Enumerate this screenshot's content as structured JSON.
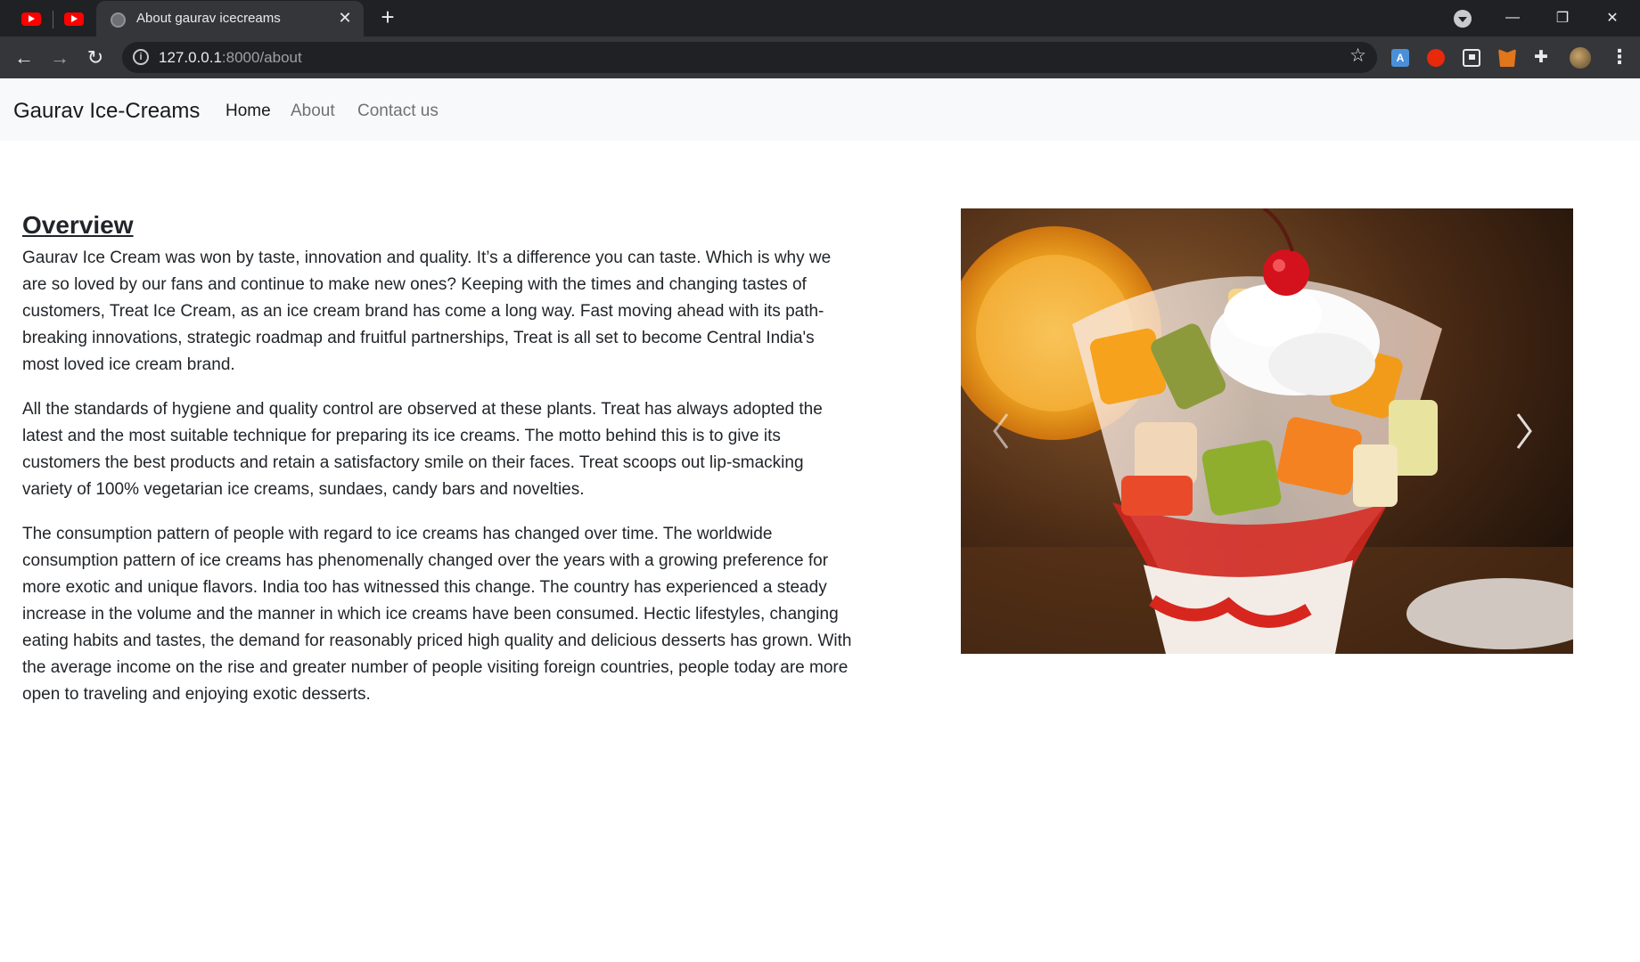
{
  "browser": {
    "active_tab_title": "About gaurav icecreams",
    "close_tab_glyph": "✕",
    "new_tab_glyph": "+",
    "url_host": "127.0.0.1",
    "url_path": ":8000/about",
    "icons": {
      "pinned_tab_1": "youtube-icon",
      "pinned_tab_2": "youtube-icon",
      "back": "back-arrow-icon",
      "forward": "forward-arrow-icon",
      "reload": "reload-icon",
      "site_info": "info-icon",
      "bookmark": "star-icon",
      "extensions": "puzzle-icon",
      "menu": "kebab-menu-icon"
    }
  },
  "navbar": {
    "brand": "Gaurav Ice-Creams",
    "links": [
      "Home",
      "About",
      "Contact us"
    ],
    "background_color": "#f8f9fa"
  },
  "main": {
    "heading": "Overview",
    "paragraphs": [
      "Gaurav Ice Cream was won by taste, innovation and quality. It’s a difference you can taste. Which is why we are so loved by our fans and continue to make new ones? Keeping with the times and changing tastes of customers, Treat Ice Cream, as an ice cream brand has come a long way. Fast moving ahead with its path-breaking innovations, strategic roadmap and fruitful partnerships, Treat is all set to become Central India's most loved ice cream brand.",
      "All the standards of hygiene and quality control are observed at these plants. Treat has always adopted the latest and the most suitable technique for preparing its ice creams. The motto behind this is to give its customers the best products and retain a satisfactory smile on their faces. Treat scoops out lip-smacking variety of 100% vegetarian ice creams, sundaes, candy bars and novelties.",
      "The consumption pattern of people with regard to ice creams has changed over time. The worldwide consumption pattern of ice creams has phenomenally changed over the years with a growing preference for more exotic and unique flavors. India too has witnessed this change. The country has experienced a steady increase in the volume and the manner in which ice creams have been consumed. Hectic lifestyles, changing eating habits and tastes, the demand for reasonably priced high quality and delicious desserts has grown. With the average income on the rise and greater number of people visiting foreign countries, people today are more open to traveling and enjoying exotic desserts."
    ]
  },
  "carousel": {
    "image": "fruit-ice-cream-sundae-photo",
    "prev_icon": "chevron-left-icon",
    "next_icon": "chevron-right-icon"
  }
}
